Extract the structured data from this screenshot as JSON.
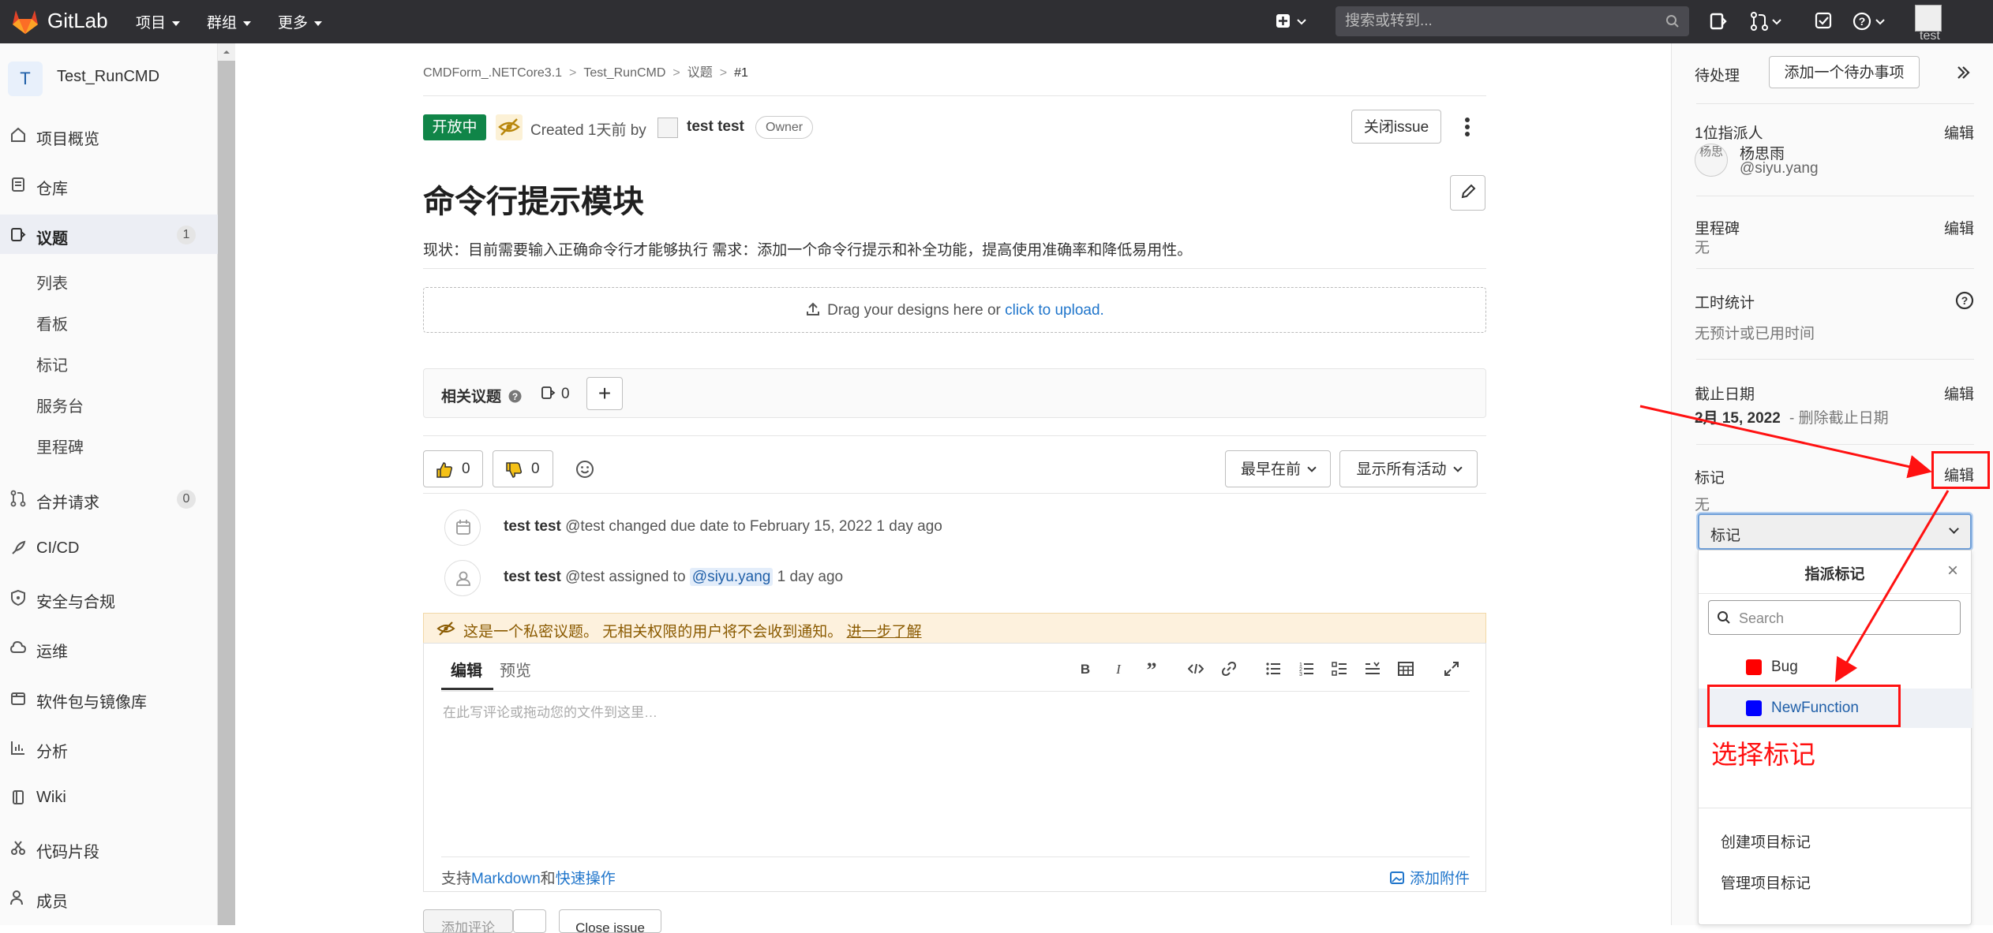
{
  "navbar": {
    "brand": "GitLab",
    "menus": [
      "项目",
      "群组",
      "更多"
    ],
    "search_placeholder": "搜索或转到...",
    "user_name": "test"
  },
  "sidebar": {
    "project_initial": "T",
    "project_name": "Test_RunCMD",
    "items": [
      {
        "label": "项目概览"
      },
      {
        "label": "仓库"
      },
      {
        "label": "议题",
        "count": "1"
      },
      {
        "label": "合并请求",
        "count": "0"
      },
      {
        "label": "CI/CD"
      },
      {
        "label": "安全与合规"
      },
      {
        "label": "运维"
      },
      {
        "label": "软件包与镜像库"
      },
      {
        "label": "分析"
      },
      {
        "label": "Wiki"
      },
      {
        "label": "代码片段"
      },
      {
        "label": "成员"
      }
    ],
    "issues_sub": [
      "列表",
      "看板",
      "标记",
      "服务台",
      "里程碑"
    ]
  },
  "breadcrumb": [
    "CMDForm_.NETCore3.1",
    "Test_RunCMD",
    "议题",
    "#1"
  ],
  "issue": {
    "status": "开放中",
    "created_prefix": "Created 1天前 by",
    "author": "test test",
    "author_role": "Owner",
    "close_label": "关闭issue",
    "title": "命令行提示模块",
    "description": "现状：目前需要输入正确命令行才能够执行 需求：添加一个命令行提示和补全功能，提高使用准确率和降低易用性。",
    "dropzone_text": "Drag your designs here or",
    "dropzone_link": "click to upload."
  },
  "related": {
    "title": "相关议题",
    "count": "0"
  },
  "awards": {
    "thumbs_up": "0",
    "thumbs_down": "0"
  },
  "sort": {
    "order_label": "最早在前",
    "filter_label": "显示所有活动"
  },
  "activities": [
    {
      "author": "test test",
      "text": "@test changed due date to February 15, 2022 1 day ago"
    },
    {
      "author": "test test",
      "text_before": "@test assigned to",
      "mention": "@siyu.yang",
      "text_after": "1 day ago"
    }
  ],
  "confidential_notice": {
    "text": "这是一个私密议题。 无相关权限的用户将不会收到通知。",
    "link": "进一步了解"
  },
  "comment": {
    "tab_edit": "编辑",
    "tab_preview": "预览",
    "placeholder": "在此写评论或拖动您的文件到这里…",
    "hint_prefix": "支持",
    "hint_markdown": "Markdown",
    "hint_and": "和",
    "hint_quick": "快速操作",
    "attach": "添加附件"
  },
  "bottom_buttons": [
    "添加评论",
    "Close issue"
  ],
  "right_sidebar": {
    "todo_label": "待处理",
    "todo_button": "添加一个待办事项",
    "assignee_title": "1位指派人",
    "edit": "编辑",
    "assignee_avatar_text": "杨思",
    "assignee_name": "杨思雨",
    "assignee_handle": "@siyu.yang",
    "milestone_title": "里程碑",
    "milestone_value": "无",
    "time_title": "工时统计",
    "time_value": "无预计或已用时间",
    "due_title": "截止日期",
    "due_date": "2月 15, 2022",
    "due_remove": "- 删除截止日期",
    "labels_title": "标记",
    "labels_value": "无",
    "labels_select": "标记"
  },
  "label_dropdown": {
    "title": "指派标记",
    "search_placeholder": "Search",
    "options": [
      {
        "name": "Bug",
        "color": "#ff0000"
      },
      {
        "name": "NewFunction",
        "color": "#0000ff"
      }
    ],
    "create_link": "创建项目标记",
    "manage_link": "管理项目标记"
  },
  "annotation": {
    "text": "选择标记",
    "color": "#ff1111"
  }
}
